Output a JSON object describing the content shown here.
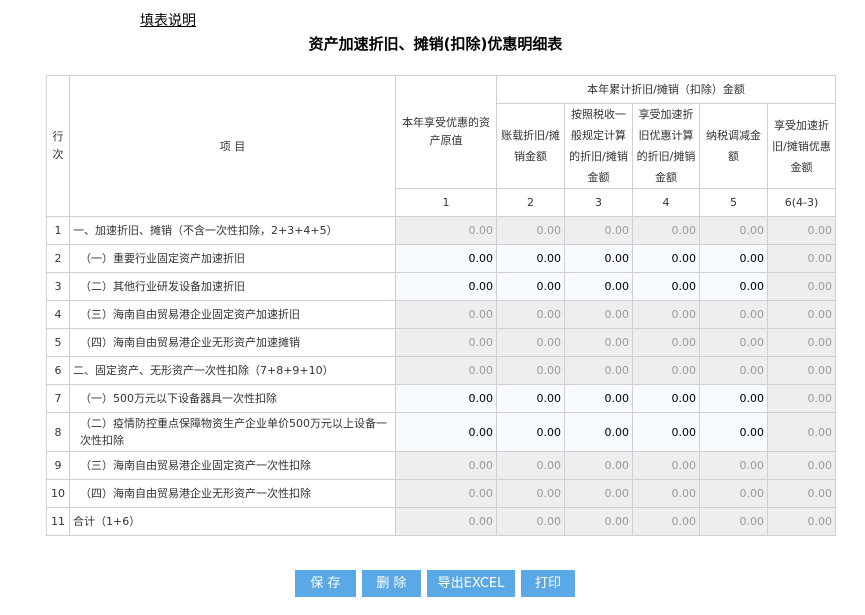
{
  "help_link": "填表说明",
  "title": "资产加速折旧、摊销(扣除)优惠明细表",
  "header": {
    "row_no": "行次",
    "item": "项 目",
    "original_value": "本年享受优惠的资产原值",
    "cumulative_group": "本年累计折旧/摊销（扣除）金额",
    "col_book": "账载折旧/摊销金额",
    "col_general": "按照税收一般规定计算的折旧/摊销金额",
    "col_accelerated": "享受加速折旧优惠计算的折旧/摊销金额",
    "col_adjust": "纳税调减金额",
    "col_benefit": "享受加速折旧/摊销优惠金额",
    "col_numbers": [
      "1",
      "2",
      "3",
      "4",
      "5",
      "6(4-3)"
    ]
  },
  "rows": [
    {
      "no": "1",
      "name": "一、加速折旧、摊销（不含一次性扣除，2+3+4+5）",
      "values": [
        "0.00",
        "0.00",
        "0.00",
        "0.00",
        "0.00",
        "0.00"
      ]
    },
    {
      "no": "2",
      "name": "（一）重要行业固定资产加速折旧",
      "values": [
        "0.00",
        "0.00",
        "0.00",
        "0.00",
        "0.00",
        "0.00"
      ]
    },
    {
      "no": "3",
      "name": "（二）其他行业研发设备加速折旧",
      "values": [
        "0.00",
        "0.00",
        "0.00",
        "0.00",
        "0.00",
        "0.00"
      ]
    },
    {
      "no": "4",
      "name": "（三）海南自由贸易港企业固定资产加速折旧",
      "values": [
        "0.00",
        "0.00",
        "0.00",
        "0.00",
        "0.00",
        "0.00"
      ]
    },
    {
      "no": "5",
      "name": "（四）海南自由贸易港企业无形资产加速摊销",
      "values": [
        "0.00",
        "0.00",
        "0.00",
        "0.00",
        "0.00",
        "0.00"
      ]
    },
    {
      "no": "6",
      "name": "二、固定资产、无形资产一次性扣除（7+8+9+10）",
      "values": [
        "0.00",
        "0.00",
        "0.00",
        "0.00",
        "0.00",
        "0.00"
      ]
    },
    {
      "no": "7",
      "name": "（一）500万元以下设备器具一次性扣除",
      "values": [
        "0.00",
        "0.00",
        "0.00",
        "0.00",
        "0.00",
        "0.00"
      ]
    },
    {
      "no": "8",
      "name": "（二）疫情防控重点保障物资生产企业单价500万元以上设备一次性扣除",
      "values": [
        "0.00",
        "0.00",
        "0.00",
        "0.00",
        "0.00",
        "0.00"
      ]
    },
    {
      "no": "9",
      "name": "（三）海南自由贸易港企业固定资产一次性扣除",
      "values": [
        "0.00",
        "0.00",
        "0.00",
        "0.00",
        "0.00",
        "0.00"
      ]
    },
    {
      "no": "10",
      "name": "（四）海南自由贸易港企业无形资产一次性扣除",
      "values": [
        "0.00",
        "0.00",
        "0.00",
        "0.00",
        "0.00",
        "0.00"
      ]
    },
    {
      "no": "11",
      "name": "合计（1+6）",
      "values": [
        "0.00",
        "0.00",
        "0.00",
        "0.00",
        "0.00",
        "0.00"
      ]
    }
  ],
  "buttons": {
    "save": "保 存",
    "delete": "删 除",
    "export": "导出EXCEL",
    "print": "打印"
  },
  "colors": {
    "button_bg": "#5aa8e6",
    "readonly_cell": "#eeeeee",
    "editable_cell": "#f7faff",
    "grid_line": "#d0d0d0"
  }
}
